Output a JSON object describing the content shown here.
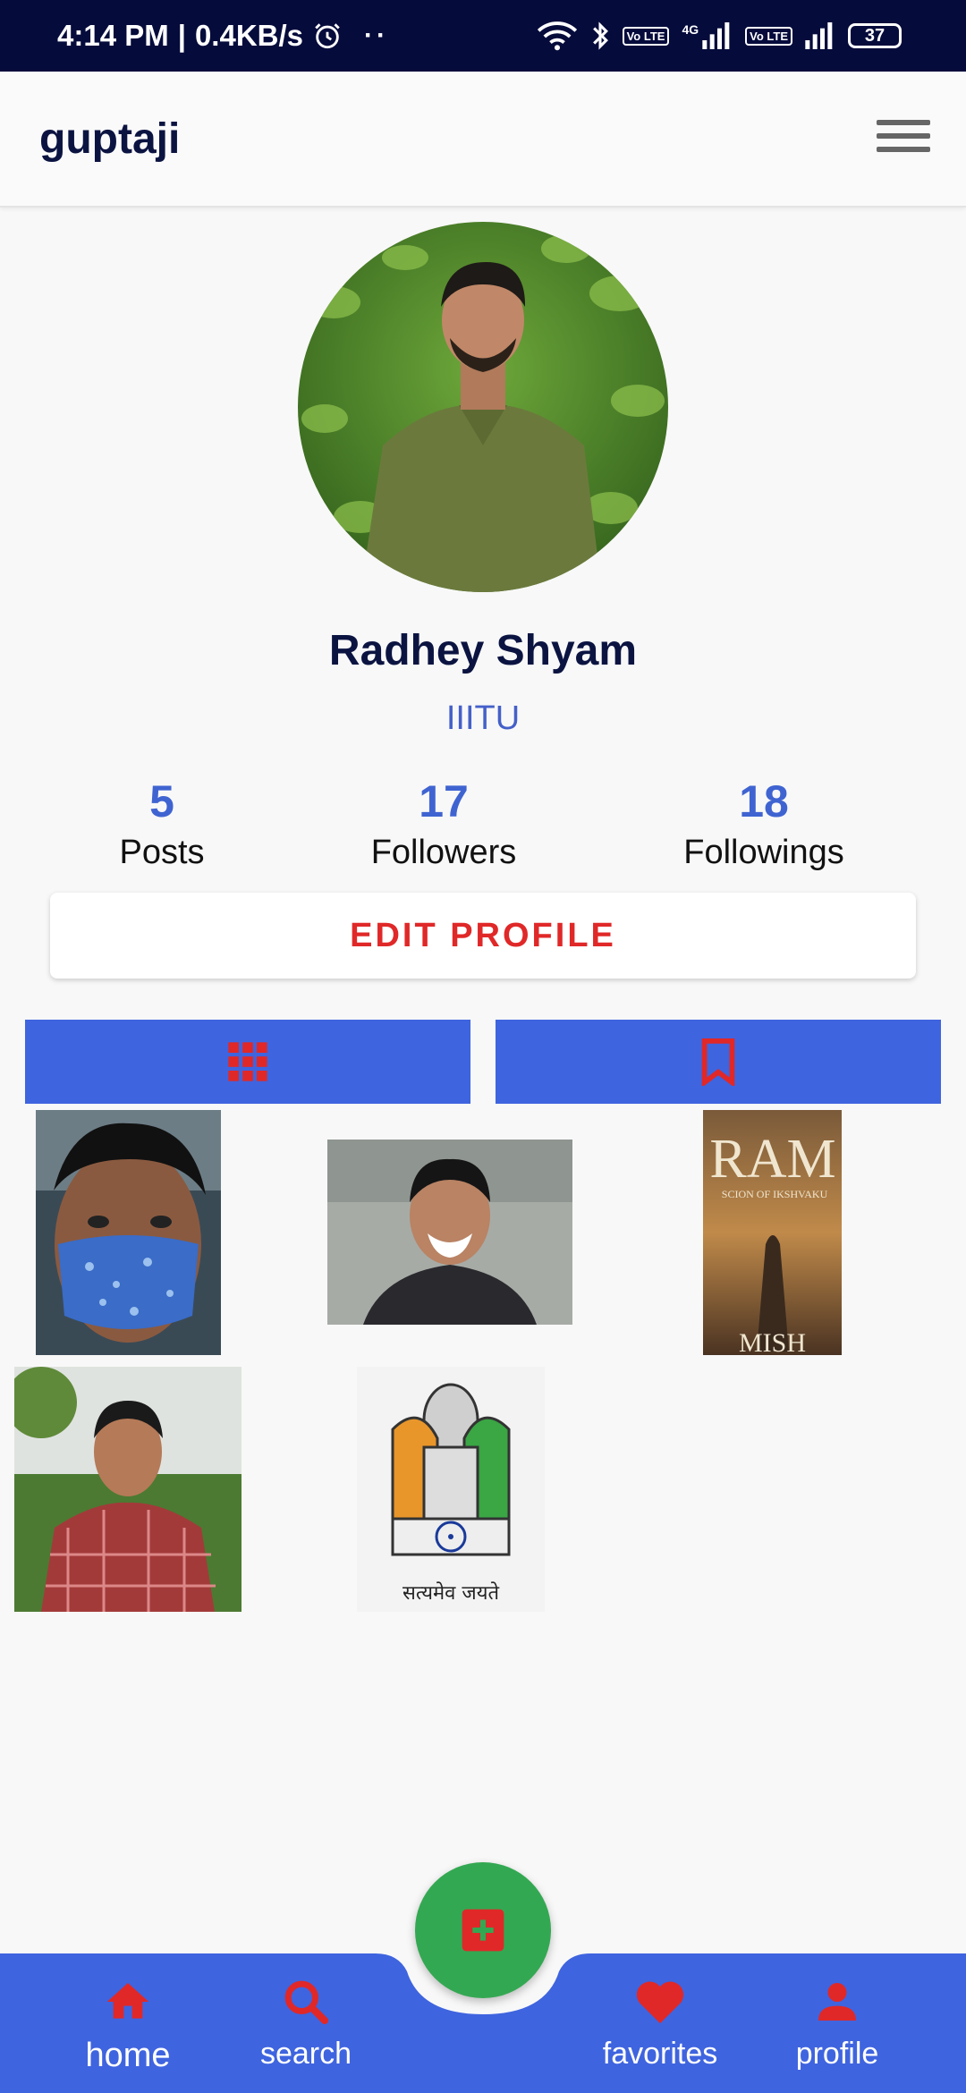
{
  "status_bar": {
    "time": "4:14 PM",
    "speed": "0.4KB/s",
    "dots": "··",
    "network_4g": "4G",
    "volte": "Vo LTE",
    "battery": "37"
  },
  "app_bar": {
    "title": "guptaji",
    "menu_icon": "hamburger-menu-icon"
  },
  "profile": {
    "name": "Radhey Shyam",
    "bio": "IIITU",
    "stats": [
      {
        "value": "5",
        "label": "Posts"
      },
      {
        "value": "17",
        "label": "Followers"
      },
      {
        "value": "18",
        "label": "Followings"
      }
    ],
    "edit_button": "EDIT PROFILE"
  },
  "tabs": [
    {
      "icon": "grid-icon"
    },
    {
      "icon": "bookmark-icon"
    }
  ],
  "posts": [
    {
      "kind": "masked-selfie"
    },
    {
      "kind": "smiling-selfie"
    },
    {
      "kind": "book-cover",
      "text": "RAM",
      "subtext": "SCION OF IKSHVAKU",
      "bottom_text": "MISH"
    },
    {
      "kind": "portrait-checked-shirt"
    },
    {
      "kind": "national-emblem",
      "caption": "सत्यमेव जयते"
    }
  ],
  "bottom_nav": {
    "items": [
      {
        "label": "home",
        "icon": "home-icon"
      },
      {
        "label": "search",
        "icon": "search-icon"
      },
      {
        "label": "favorites",
        "icon": "heart-icon"
      },
      {
        "label": "profile",
        "icon": "person-icon"
      }
    ],
    "fab_icon": "add-box-icon"
  },
  "colors": {
    "accent_blue": "#3f64df",
    "accent_red": "#e02828",
    "fab_green": "#33a852",
    "title_navy": "#0b1441"
  }
}
